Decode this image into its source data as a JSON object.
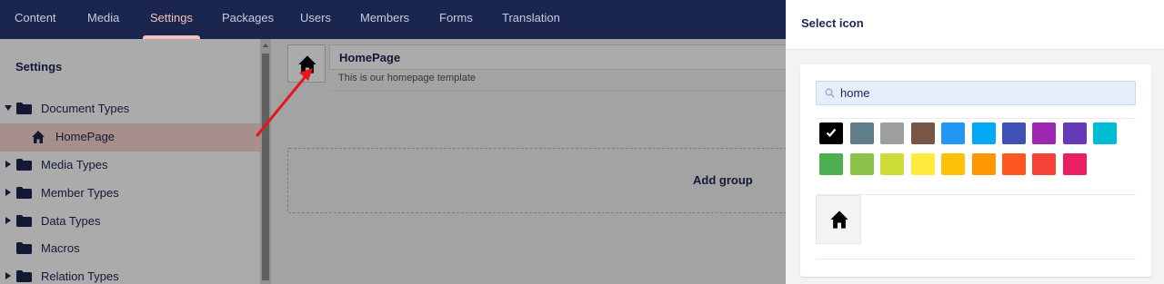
{
  "topnav": {
    "tabs": [
      {
        "label": "Content"
      },
      {
        "label": "Media"
      },
      {
        "label": "Settings",
        "active": true
      },
      {
        "label": "Packages"
      },
      {
        "label": "Users"
      },
      {
        "label": "Members"
      },
      {
        "label": "Forms"
      },
      {
        "label": "Translation"
      }
    ]
  },
  "sidebar": {
    "title": "Settings",
    "items": [
      {
        "label": "Document Types",
        "icon": "folder-icon",
        "expanded": true
      },
      {
        "label": "HomePage",
        "icon": "home-icon",
        "selected": true
      },
      {
        "label": "Media Types",
        "icon": "folder-icon"
      },
      {
        "label": "Member Types",
        "icon": "folder-icon"
      },
      {
        "label": "Data Types",
        "icon": "folder-icon"
      },
      {
        "label": "Macros",
        "icon": "folder-icon"
      },
      {
        "label": "Relation Types",
        "icon": "folder-icon"
      }
    ]
  },
  "editor": {
    "name": "HomePage",
    "description": "This is our homepage template",
    "add_group_label": "Add group",
    "icon": "home-icon"
  },
  "panel": {
    "title": "Select icon",
    "search": {
      "value": "home",
      "icon": "search-icon"
    },
    "colors": [
      {
        "name": "black",
        "hex": "#000000",
        "selected": true
      },
      {
        "name": "blue-grey",
        "hex": "#607d8b"
      },
      {
        "name": "grey",
        "hex": "#9e9e9e"
      },
      {
        "name": "brown",
        "hex": "#795548"
      },
      {
        "name": "blue",
        "hex": "#2196f3"
      },
      {
        "name": "light-blue",
        "hex": "#03a9f4"
      },
      {
        "name": "indigo",
        "hex": "#3f51b5"
      },
      {
        "name": "purple",
        "hex": "#9c27b0"
      },
      {
        "name": "deep-purple",
        "hex": "#673ab7"
      },
      {
        "name": "cyan",
        "hex": "#00bcd4"
      },
      {
        "name": "green",
        "hex": "#4caf50"
      },
      {
        "name": "light-green",
        "hex": "#8bc34a"
      },
      {
        "name": "lime",
        "hex": "#cddc39"
      },
      {
        "name": "yellow",
        "hex": "#ffeb3b"
      },
      {
        "name": "amber",
        "hex": "#ffc107"
      },
      {
        "name": "orange",
        "hex": "#ff9800"
      },
      {
        "name": "deep-orange",
        "hex": "#ff5722"
      },
      {
        "name": "red",
        "hex": "#f44336"
      },
      {
        "name": "pink",
        "hex": "#e91e63"
      }
    ],
    "results": [
      {
        "icon": "home-icon"
      }
    ]
  },
  "annotation": {
    "type": "red-arrow",
    "color": "#e8141b"
  }
}
